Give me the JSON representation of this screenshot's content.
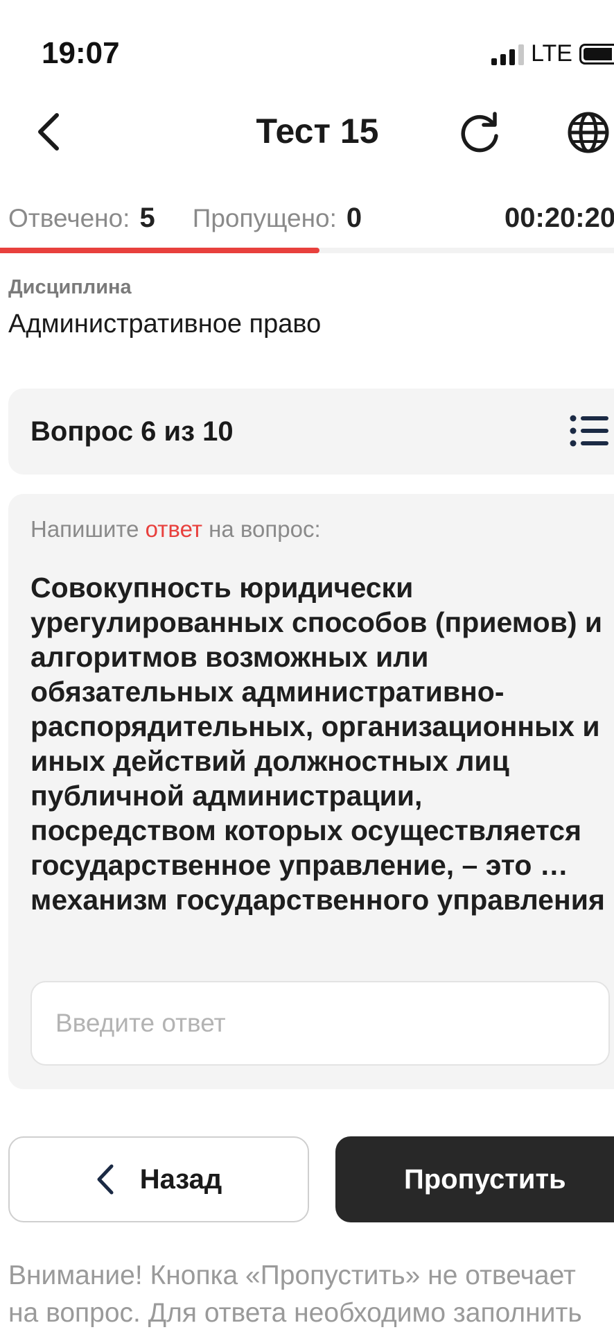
{
  "status_bar": {
    "time": "19:07",
    "network": "LTE"
  },
  "header": {
    "title": "Тест 15"
  },
  "stats": {
    "answered_label": "Отвечено:",
    "answered_value": "5",
    "skipped_label": "Пропущено:",
    "skipped_value": "0",
    "timer": "00:20:20",
    "progress": 0.52
  },
  "discipline": {
    "label": "Дисциплина",
    "value": "Административное право"
  },
  "question": {
    "counter": "Вопрос 6 из 10",
    "instruction_prefix": "Напишите",
    "instruction_accent": "ответ",
    "instruction_suffix": "на вопрос:",
    "text": "Совокупность юридически урегулированных способов (приемов) и алгоритмов возможных или обязательных административно-распорядительных, организационных и иных действий должностных лиц публичной администрации, посредством которых осуществляется государственное управление, – это … механизм государственного управления",
    "answer_placeholder": "Введите ответ",
    "answer_value": ""
  },
  "buttons": {
    "back": "Назад",
    "skip": "Пропустить"
  },
  "warning": {
    "line1": "Внимание! Кнопка «Пропустить» не отвечает",
    "line2": "на вопрос. Для ответа необходимо заполнить"
  },
  "colors": {
    "accent": "#e8403d",
    "dark_button": "#282828",
    "card_bg": "#f4f4f4",
    "icon_navy": "#1b2a44"
  }
}
